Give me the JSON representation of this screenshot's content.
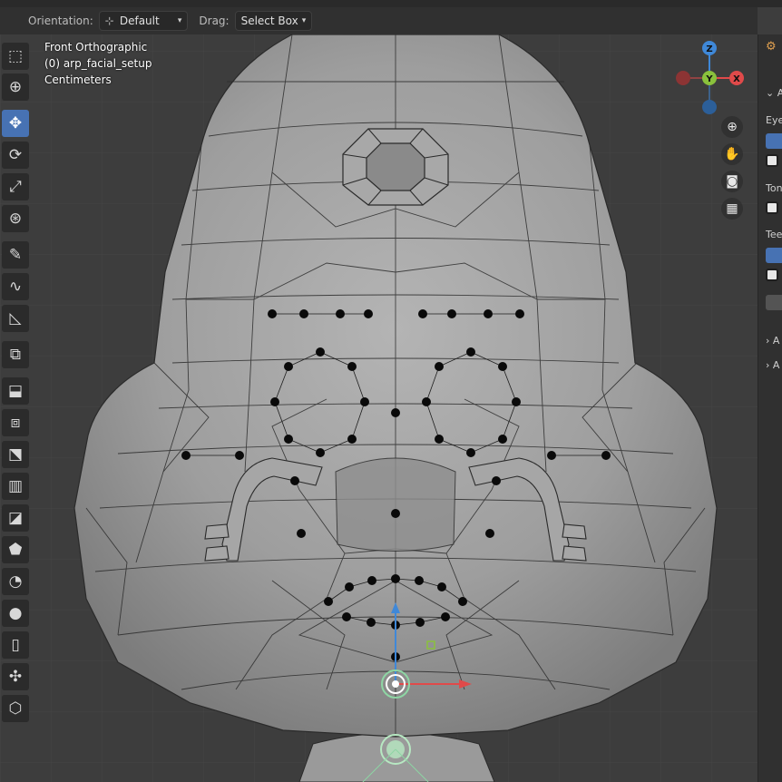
{
  "header": {
    "orientation_label": "Orientation:",
    "orientation_value": "Default",
    "drag_label": "Drag:",
    "drag_value": "Select Box"
  },
  "overlay": {
    "view_name": "Front Orthographic",
    "object_name": "(0) arp_facial_setup",
    "units": "Centimeters"
  },
  "gizmo": {
    "z_label": "Z",
    "y_label": "Y",
    "x_label": "X"
  },
  "toolbar_icons": [
    "select-box-icon",
    "cursor-icon",
    "move-icon",
    "rotate-icon",
    "scale-icon",
    "transform-icon",
    "annotate-icon",
    "annotate-line-icon",
    "measure-icon",
    "add-cube-icon",
    "extrude-icon",
    "inset-icon",
    "bevel-icon",
    "loop-cut-icon",
    "knife-icon",
    "poly-build-icon",
    "spin-icon",
    "smooth-icon",
    "edge-slide-icon",
    "shrink-fatten-icon",
    "shear-icon",
    "rip-icon"
  ],
  "sidebar": {
    "sections": [
      "Eyeb",
      "Tong",
      "Teet"
    ],
    "collapsed_a": [
      "A",
      "A",
      "A"
    ]
  },
  "colors": {
    "active_tool": "#4772b3",
    "gizmo_x": "#e04a4a",
    "gizmo_y": "#8ac13c",
    "gizmo_z": "#3f88d8",
    "mesh": "#9c9c9c"
  }
}
